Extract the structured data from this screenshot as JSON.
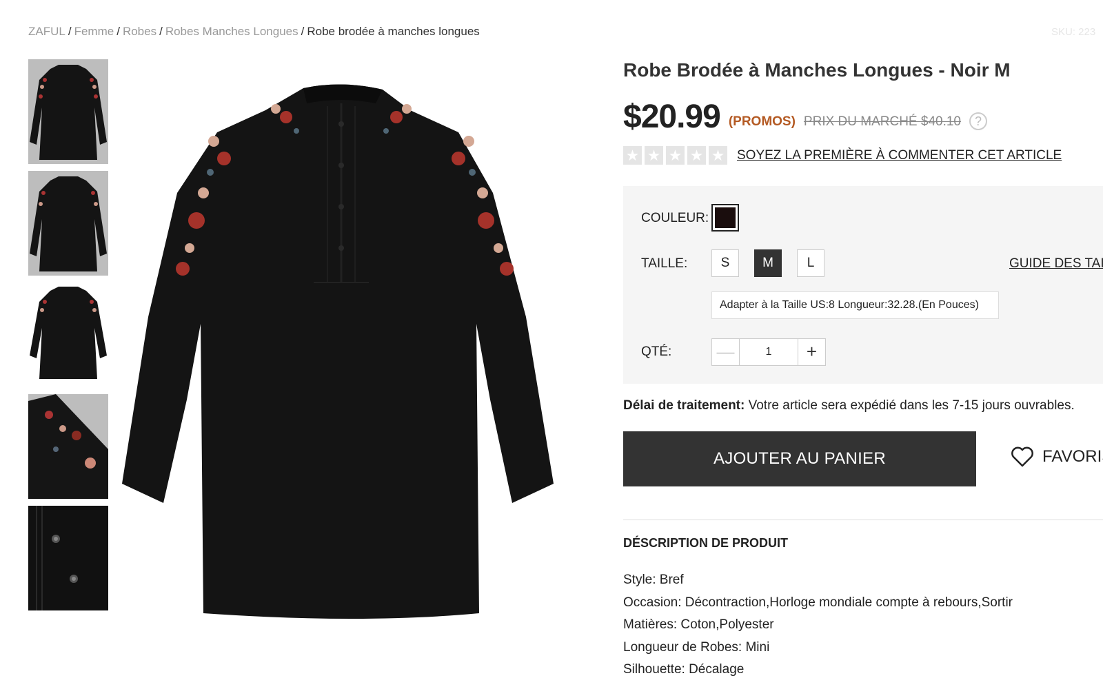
{
  "breadcrumb": {
    "items": [
      "ZAFUL",
      "Femme",
      "Robes",
      "Robes Manches Longues"
    ],
    "current": "Robe brodée à manches longues",
    "separator": "/"
  },
  "sku_text": "SKU: 223",
  "gallery": {
    "thumbnails": [
      "front-view",
      "back-view",
      "front-view-white",
      "sleeve-detail",
      "button-detail"
    ]
  },
  "product": {
    "title": "Robe Brodée à Manches Longues - Noir M",
    "price": "$20.99",
    "promo_label": "(PROMOS)",
    "market_price": "PRIX DU MARCHÉ $40.10",
    "help_icon": "?",
    "review_link": "SOYEZ LA PREMIÈRE À COMMENTER CET ARTICLE",
    "stars": 0
  },
  "options": {
    "color_label": "COULEUR:",
    "color_value": "#1a0d0d",
    "size_label": "TAILLE:",
    "sizes": [
      "S",
      "M",
      "L"
    ],
    "selected_size": "M",
    "size_guide": "GUIDE DES TAIL",
    "fit_text": "Adapter à la Taille US:8   Longueur:32.28.(En Pouces)",
    "qty_label": "QTÉ:",
    "qty_value": "1",
    "qty_minus": "—",
    "qty_plus": "+"
  },
  "shipping": {
    "label": "Délai de traitement:",
    "text": " Votre article sera expédié dans les 7-15 jours ouvrables."
  },
  "actions": {
    "add_to_cart": "AJOUTER AU PANIER",
    "favorite": "FAVORIS"
  },
  "description": {
    "title": "DÉSCRIPTION DE PRODUIT",
    "items": [
      "Style: Bref",
      "Occasion: Décontraction,Horloge mondiale compte à rebours,Sortir",
      "Matières: Coton,Polyester",
      "Longueur de Robes: Mini",
      "Silhouette: Décalage"
    ]
  },
  "colors": {
    "accent_promo": "#b45a23",
    "button_dark": "#333333",
    "option_bg": "#f5f5f5"
  }
}
